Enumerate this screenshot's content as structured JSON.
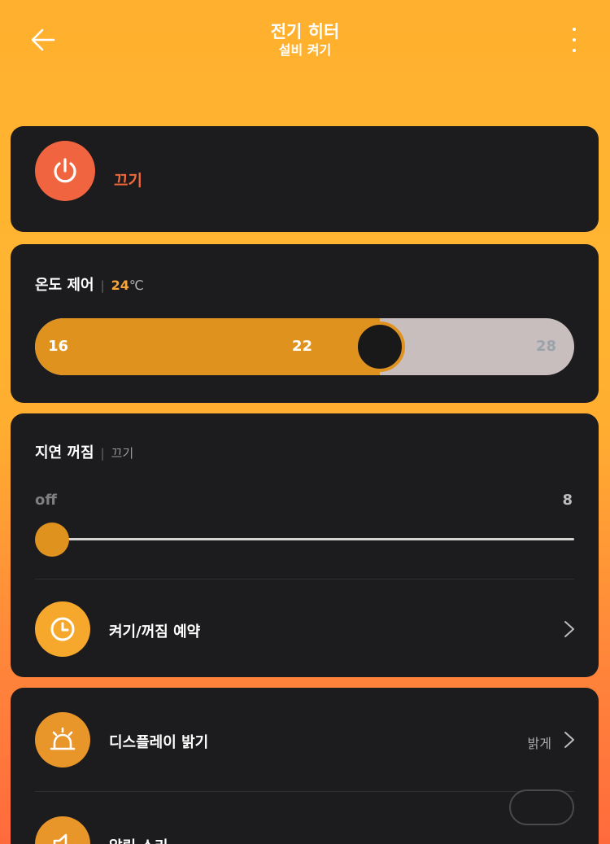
{
  "header": {
    "title": "전기 히터",
    "subtitle": "설비 켜기"
  },
  "power": {
    "label": "끄기",
    "state": "on"
  },
  "temperature": {
    "title": "온도 제어",
    "current": "24",
    "unit": "℃",
    "min_label": "16",
    "mid_label": "22",
    "max_label": "28",
    "min": 16,
    "max": 28,
    "value": 24
  },
  "delay_off": {
    "title": "지연 꺼짐",
    "status": "끄기",
    "min_label": "off",
    "max_label": "8",
    "level": 0
  },
  "schedule": {
    "label": "켜기/꺼짐 예약"
  },
  "display": {
    "label": "디스플레이 밝기",
    "value": "밝게"
  },
  "sound": {
    "label": "알림 소리"
  },
  "colors": {
    "accent": "#e0921e",
    "power_red": "#f0653f",
    "card_bg": "#1c1b1d"
  }
}
